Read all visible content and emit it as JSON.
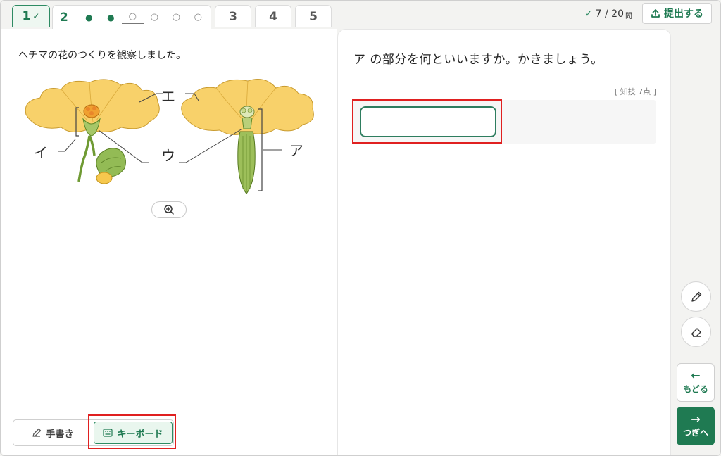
{
  "header": {
    "tabs": [
      {
        "label": "1",
        "check": "✓"
      },
      {
        "label": "2"
      },
      {
        "label": "3"
      },
      {
        "label": "4"
      },
      {
        "label": "5"
      }
    ],
    "subquestions": [
      "●",
      "●",
      "○",
      "○",
      "○",
      "○"
    ],
    "progress": {
      "check": "✓",
      "text": "7 / 20",
      "unit": "問"
    },
    "submit_label": "提出する"
  },
  "left": {
    "prompt": "ヘチマの花のつくりを観察しました。",
    "labels": {
      "a": "ア",
      "i": "イ",
      "u": "ウ",
      "e": "エ"
    },
    "mode": {
      "handwriting": "手書き",
      "keyboard": "キーボード"
    }
  },
  "right": {
    "question": "ア の部分を何といいますか。かきましょう。",
    "points": "[ 知技 7点 ]",
    "answer_value": ""
  },
  "rail": {
    "back_label": "もどる",
    "next_label": "つぎへ",
    "back_arrow": "←",
    "next_arrow": "→"
  },
  "colors": {
    "accent": "#1f7a52",
    "petal": "#f8d16a",
    "highlight": "#e02020"
  }
}
